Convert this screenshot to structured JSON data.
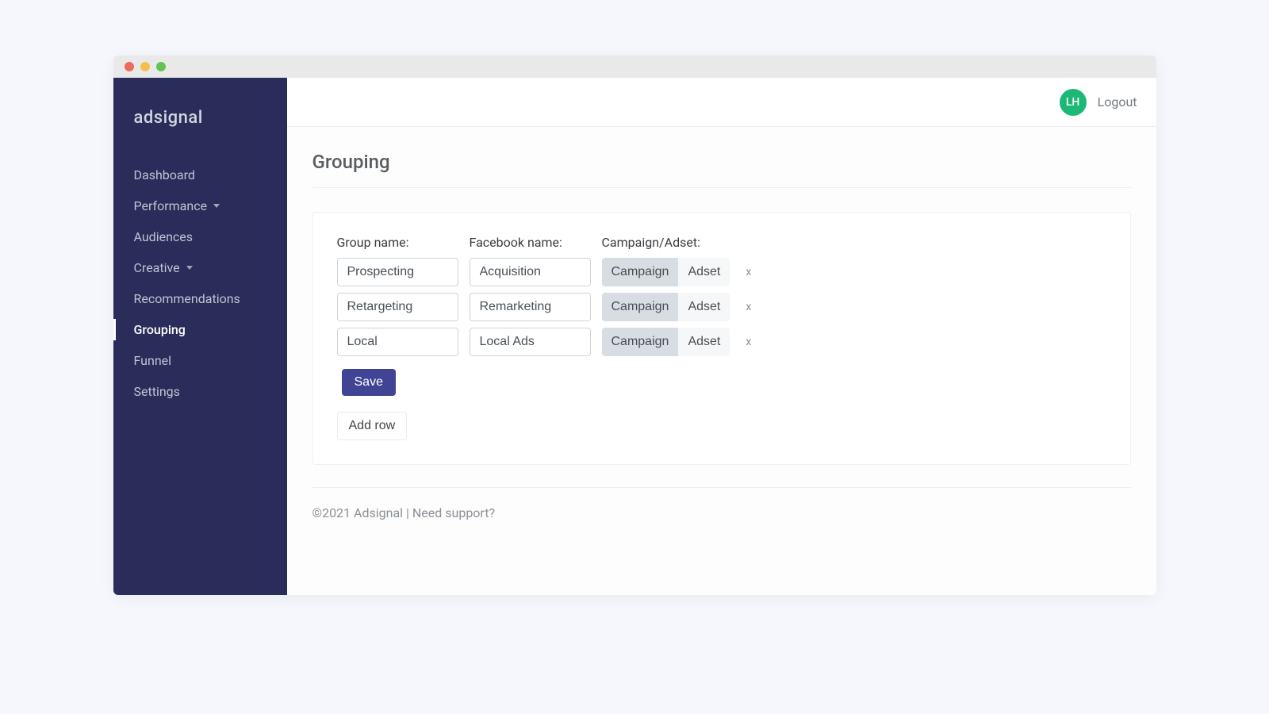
{
  "brand": "adsignal",
  "sidebar": {
    "items": [
      {
        "label": "Dashboard",
        "has_caret": false,
        "active": false
      },
      {
        "label": "Performance",
        "has_caret": true,
        "active": false
      },
      {
        "label": "Audiences",
        "has_caret": false,
        "active": false
      },
      {
        "label": "Creative",
        "has_caret": true,
        "active": false
      },
      {
        "label": "Recommendations",
        "has_caret": false,
        "active": false
      },
      {
        "label": "Grouping",
        "has_caret": false,
        "active": true
      },
      {
        "label": "Funnel",
        "has_caret": false,
        "active": false
      },
      {
        "label": "Settings",
        "has_caret": false,
        "active": false
      }
    ]
  },
  "header": {
    "avatar_initials": "LH",
    "logout_label": "Logout"
  },
  "page": {
    "title": "Grouping",
    "columns": {
      "group_name": "Group name:",
      "facebook_name": "Facebook name:",
      "campaign_adset": "Campaign/Adset:"
    },
    "toggle_options": {
      "campaign": "Campaign",
      "adset": "Adset"
    },
    "rows": [
      {
        "group_name": "Prospecting",
        "facebook_name": "Acquisition",
        "selected": "campaign"
      },
      {
        "group_name": "Retargeting",
        "facebook_name": "Remarketing",
        "selected": "campaign"
      },
      {
        "group_name": "Local",
        "facebook_name": "Local Ads",
        "selected": "campaign"
      }
    ],
    "remove_label": "x",
    "save_label": "Save",
    "add_row_label": "Add row"
  },
  "footer": {
    "copyright": "©2021 Adsignal | ",
    "support_label": "Need support?"
  }
}
